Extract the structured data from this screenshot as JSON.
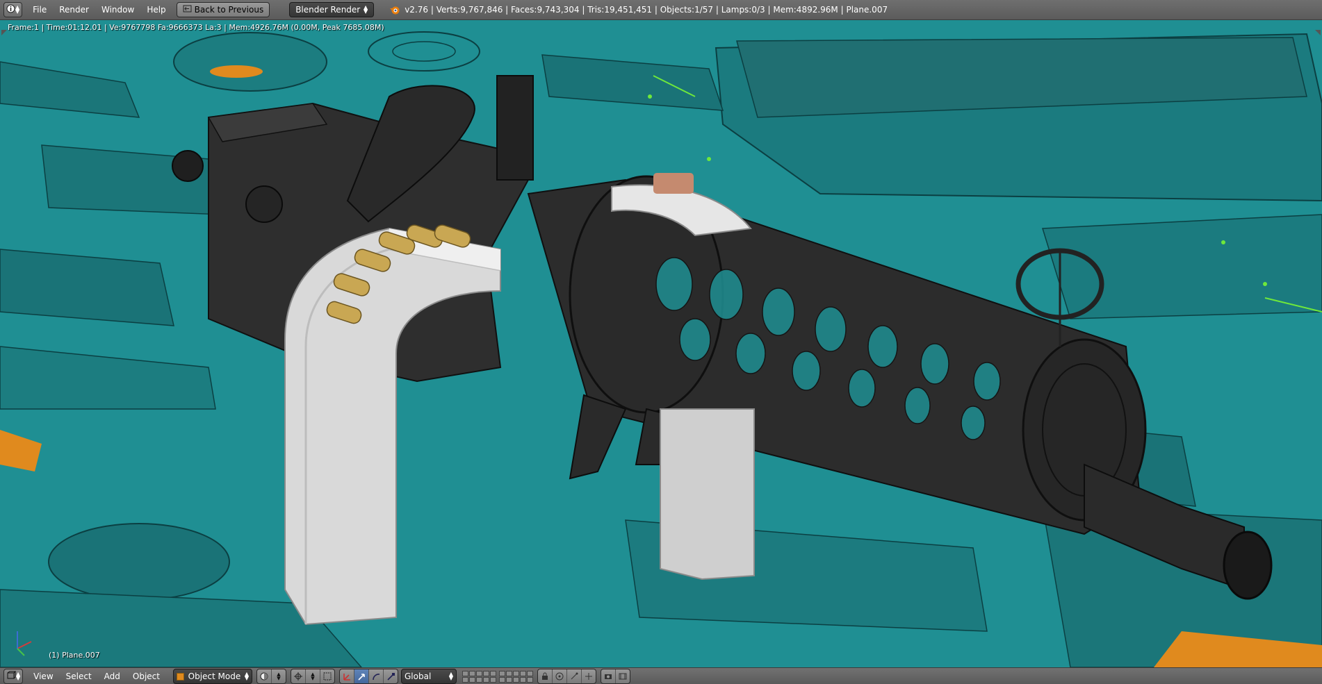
{
  "header": {
    "editor_icon": "info-editor-icon",
    "menus": [
      "File",
      "Render",
      "Window",
      "Help"
    ],
    "back_button": "Back to Previous",
    "render_engine": "Blender Render",
    "stats": "v2.76 | Verts:9,767,846 | Faces:9,743,304 | Tris:19,451,451 | Objects:1/57 | Lamps:0/3 | Mem:4892.96M | Plane.007"
  },
  "viewport": {
    "render_info": "Frame:1 | Time:01:12.01 | Ve:9767798 Fa:9666373 La:3 | Mem:4926.76M (0.00M, Peak 7685.08M)",
    "active_object": "(1) Plane.007",
    "background_color": "#1f8f93"
  },
  "footer": {
    "editor_icon": "3d-view-editor-icon",
    "menus": [
      "View",
      "Select",
      "Add",
      "Object"
    ],
    "mode": "Object Mode",
    "shading_icon": "viewport-shading-icon",
    "pivot_icon": "pivot-point-icon",
    "transform_orientation": "Global",
    "tools": [
      "manipulator-icon",
      "translate-icon",
      "rotate-icon",
      "scale-icon"
    ]
  },
  "colors": {
    "header_bg": "#636363",
    "selected_tool": "#5076ad",
    "model_dark": "#2e2e2e",
    "model_white": "#d6d6d6",
    "cartridge_brass": "#c9a753"
  }
}
